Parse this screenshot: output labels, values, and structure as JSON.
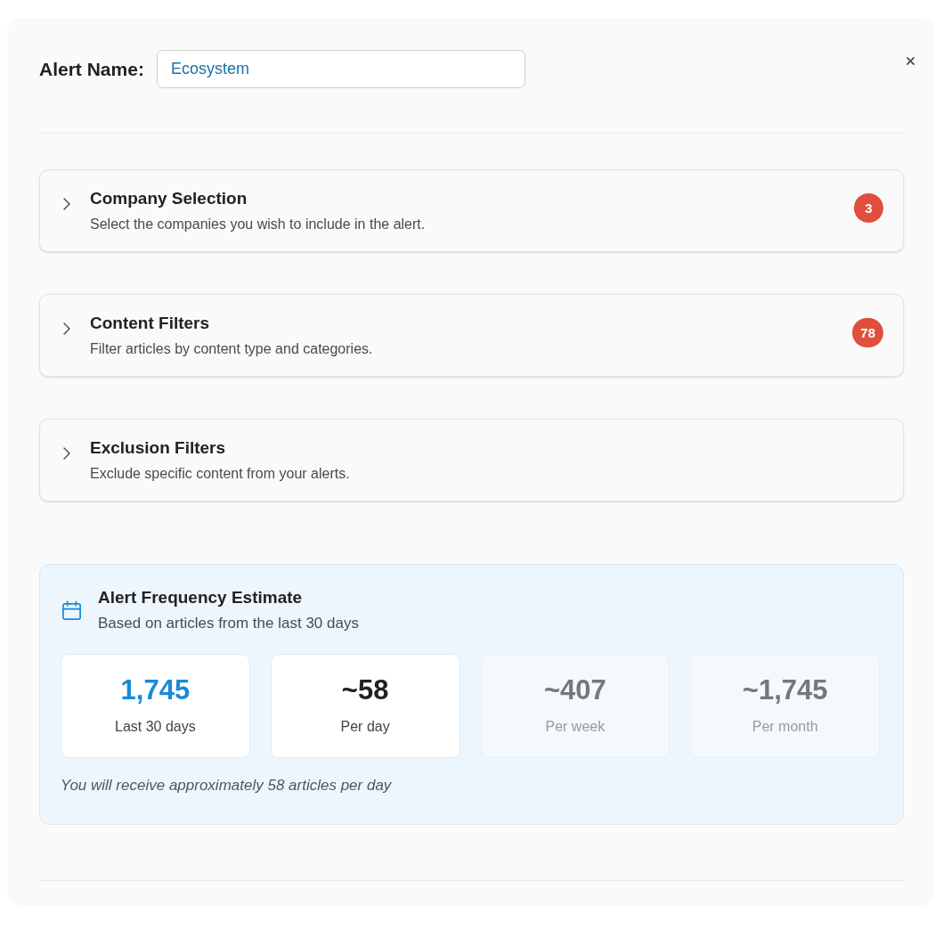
{
  "alert_name": {
    "label": "Alert Name:",
    "value": "Ecosystem"
  },
  "sections": [
    {
      "title": "Company Selection",
      "description": "Select the companies you wish to include in the alert.",
      "expanded": false,
      "badge": "3"
    },
    {
      "title": "Content Filters",
      "description": "Filter articles by content type and categories.",
      "expanded": false,
      "badge": "78"
    },
    {
      "title": "Exclusion Filters",
      "description": "Exclude specific content from your alerts.",
      "expanded": false
    }
  ],
  "frequency_estimate": {
    "title": "Alert Frequency Estimate",
    "subtitle": "Based on articles from the last 30 days",
    "stats": [
      {
        "value": "1,745",
        "label": "Last 30 days",
        "kind": "highlight"
      },
      {
        "value": "~58",
        "label": "Per day",
        "kind": "normal"
      },
      {
        "value": "~407",
        "label": "Per week",
        "kind": "dimmed"
      },
      {
        "value": "~1,745",
        "label": "Per month",
        "kind": "dimmed"
      }
    ],
    "summary": "You will receive approximately 58 articles per day"
  }
}
